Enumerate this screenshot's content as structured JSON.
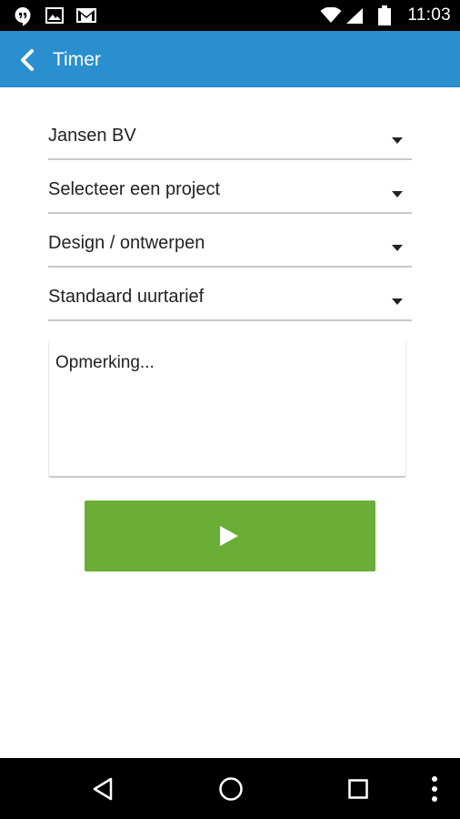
{
  "status_bar": {
    "time": "11:03",
    "icons": [
      "hangouts-icon",
      "image-icon",
      "gmail-icon",
      "wifi-icon",
      "signal-icon",
      "battery-icon"
    ]
  },
  "app_bar": {
    "title": "Timer",
    "back_icon": "chevron-left-icon",
    "color": "#2a8fcf"
  },
  "form": {
    "client_select": {
      "value": "Jansen BV"
    },
    "project_select": {
      "value": "Selecteer een project"
    },
    "activity_select": {
      "value": "Design / ontwerpen"
    },
    "rate_select": {
      "value": "Standaard uurtarief"
    },
    "remark_field": {
      "placeholder": "Opmerking..."
    },
    "start_button": {
      "icon": "play-icon",
      "color": "#6aae37"
    }
  },
  "nav_bar": {
    "buttons": [
      "back-triangle-icon",
      "home-circle-icon",
      "recents-square-icon",
      "overflow-menu-icon"
    ]
  }
}
